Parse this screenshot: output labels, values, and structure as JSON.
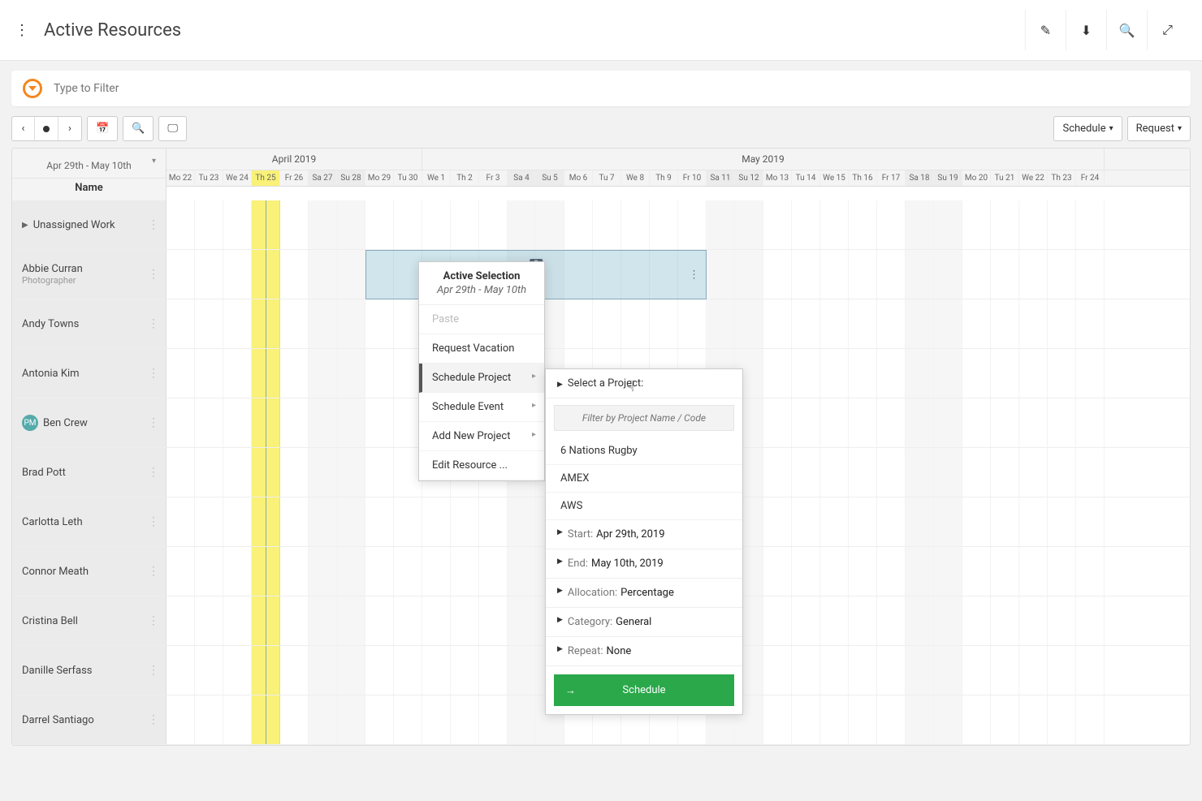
{
  "header": {
    "title": "Active Resources"
  },
  "filter": {
    "placeholder": "Type to Filter"
  },
  "toolbar": {
    "schedule_label": "Schedule",
    "request_label": "Request"
  },
  "schedule": {
    "range_label": "Apr 29th - May 10th",
    "name_header": "Name",
    "months": [
      {
        "label": "April 2019",
        "span": 9
      },
      {
        "label": "May 2019",
        "span": 24
      }
    ],
    "days": [
      "Mo 22",
      "Tu 23",
      "We 24",
      "Th 25",
      "Fr 26",
      "Sa 27",
      "Su 28",
      "Mo 29",
      "Tu 30",
      "We 1",
      "Th 2",
      "Fr 3",
      "Sa 4",
      "Su 5",
      "Mo 6",
      "Tu 7",
      "We 8",
      "Th 9",
      "Fr 10",
      "Sa 11",
      "Su 12",
      "Mo 13",
      "Tu 14",
      "We 15",
      "Th 16",
      "Fr 17",
      "Sa 18",
      "Su 19",
      "Mo 20",
      "Tu 21",
      "We 22",
      "Th 23",
      "Fr 24"
    ],
    "today_index": 3,
    "resources": [
      {
        "name": "Unassigned Work",
        "role": "",
        "unassigned": true
      },
      {
        "name": "Abbie Curran",
        "role": "Photographer"
      },
      {
        "name": "Andy Towns",
        "role": ""
      },
      {
        "name": "Antonia Kim",
        "role": ""
      },
      {
        "name": "Ben Crew",
        "role": "",
        "avatar": "PM"
      },
      {
        "name": "Brad Pott",
        "role": ""
      },
      {
        "name": "Carlotta Leth",
        "role": ""
      },
      {
        "name": "Connor Meath",
        "role": ""
      },
      {
        "name": "Cristina Bell",
        "role": ""
      },
      {
        "name": "Danille Serfass",
        "role": ""
      },
      {
        "name": "Darrel Santiago",
        "role": ""
      }
    ],
    "selection": {
      "resource_index": 1,
      "start_day_index": 7,
      "end_day_index": 18,
      "count": "8"
    }
  },
  "context_menu": {
    "title": "Active Selection",
    "subtitle": "Apr 29th - May 10th",
    "items": {
      "paste": "Paste",
      "request_vacation": "Request Vacation",
      "schedule_project": "Schedule Project",
      "schedule_event": "Schedule Event",
      "add_new_project": "Add New Project",
      "edit_resource": "Edit Resource ..."
    }
  },
  "sub_panel": {
    "select_project": "Select a Project:",
    "filter_placeholder": "Filter by Project Name / Code",
    "projects": [
      "6 Nations Rugby",
      "AMEX",
      "AWS"
    ],
    "start_label": "Start:",
    "start_value": "Apr 29th, 2019",
    "end_label": "End:",
    "end_value": "May 10th, 2019",
    "allocation_label": "Allocation:",
    "allocation_value": "Percentage",
    "category_label": "Category:",
    "category_value": "General",
    "repeat_label": "Repeat:",
    "repeat_value": "None",
    "schedule_button": "Schedule"
  }
}
